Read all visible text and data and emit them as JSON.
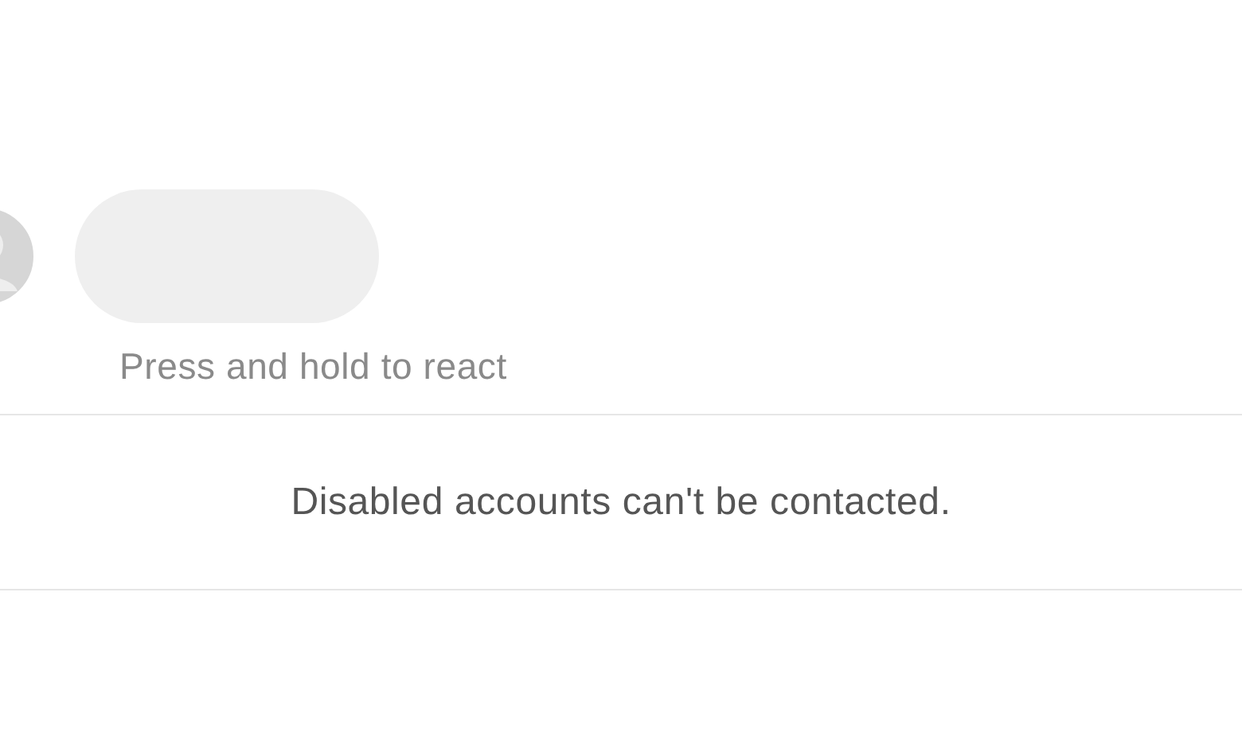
{
  "message": {
    "hint": "Press and hold to react"
  },
  "notice": "Disabled accounts can't be contacted."
}
